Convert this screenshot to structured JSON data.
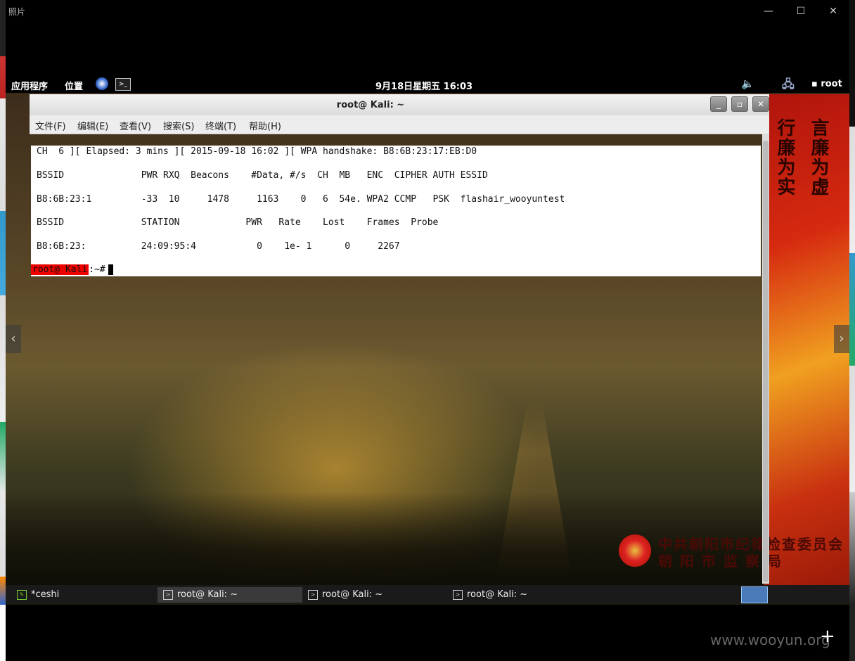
{
  "viewer": {
    "title": "照片",
    "minimize": "—",
    "maximize": "☐",
    "close": "✕",
    "prev": "‹",
    "next": "›",
    "site_watermark": "www.wooyun.org",
    "plus": "+"
  },
  "kali_panel": {
    "apps": "应用程序",
    "places": "位置",
    "clock": "9月18日星期五 16:03",
    "user": "root"
  },
  "photo_text": {
    "banner_left": "行廉为实",
    "banner_right": "言廉为虚",
    "org_line1": "中共朝阳市纪律检查委员会",
    "org_line2": "朝 阳 市 监 察 局"
  },
  "terminal": {
    "title": "root@      Kali: ~",
    "menu": [
      "文件(F)",
      "编辑(E)",
      "查看(V)",
      "搜索(S)",
      "终端(T)",
      "帮助(H)"
    ],
    "lines": [
      "CH  6 ][ Elapsed: 3 mins ][ 2015-09-18 16:02 ][ WPA handshake: B8:6B:23:17:EB:D0",
      "BSSID              PWR RXQ  Beacons    #Data, #/s  CH  MB   ENC  CIPHER AUTH ESSID",
      "B8:6B:23:1         -33  10     1478     1163    0   6  54e. WPA2 CCMP   PSK  flashair_wooyuntest",
      "BSSID              STATION            PWR   Rate    Lost    Frames  Probe",
      "B8:6B:23:          24:09:95:4           0    1e- 1      0     2267"
    ],
    "prompt_user": "root@    Kali",
    "prompt_path": ":~#"
  },
  "taskbar": {
    "tasks": [
      "*ceshi",
      "root@      Kali: ~",
      "root@      Kali: ~",
      "root@      Kali: ~"
    ]
  }
}
